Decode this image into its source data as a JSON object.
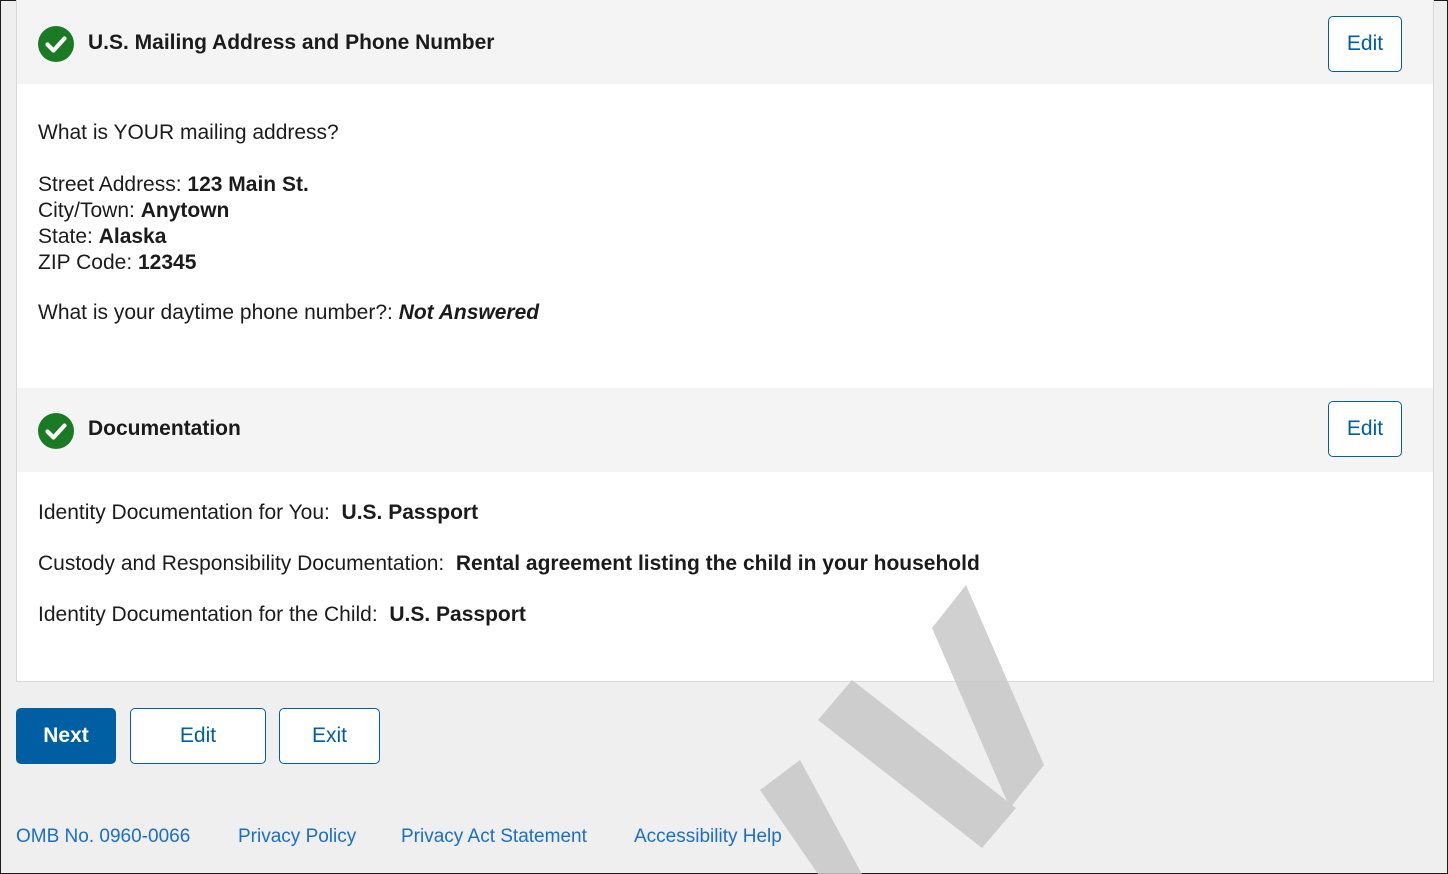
{
  "mailing_section": {
    "title": "U.S. Mailing Address and Phone Number",
    "edit_label": "Edit",
    "question": "What is YOUR mailing address?",
    "street_label": "Street Address: ",
    "street_value": "123 Main St.",
    "city_label": "City/Town: ",
    "city_value": "Anytown",
    "state_label": "State: ",
    "state_value": "Alaska",
    "zip_label": "ZIP Code: ",
    "zip_value": "12345",
    "phone_label": "What is your daytime phone number?: ",
    "phone_value": "Not Answered"
  },
  "documentation_section": {
    "title": "Documentation",
    "edit_label": "Edit",
    "identity_you_label": "Identity Documentation for You:  ",
    "identity_you_value": "U.S. Passport",
    "custody_label": "Custody and Responsibility Documentation:  ",
    "custody_value": "Rental agreement listing the child in your household",
    "identity_child_label": "Identity Documentation for the Child:  ",
    "identity_child_value": "U.S. Passport"
  },
  "actions": {
    "next_label": "Next",
    "edit_label": "Edit",
    "exit_label": "Exit"
  },
  "footer": {
    "links": [
      "OMB No. 0960-0066",
      "Privacy Policy",
      "Privacy Act Statement",
      "Accessibility Help"
    ]
  },
  "icons": {
    "section_status": "check-circle-icon"
  },
  "colors": {
    "success_green": "#1b7a24",
    "primary_blue": "#005ea2",
    "link_blue": "#1a6fc2",
    "watermark_gray": "#c8c8c8"
  }
}
